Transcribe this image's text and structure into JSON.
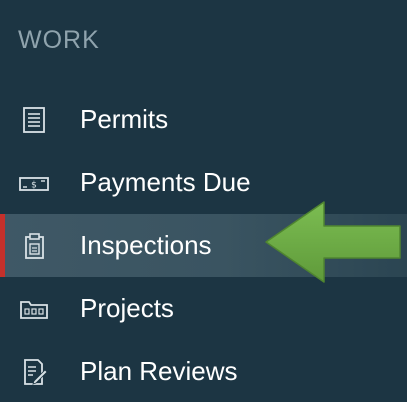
{
  "sidebar": {
    "section_title": "WORK",
    "items": [
      {
        "label": "Permits",
        "icon": "document-icon",
        "active": false
      },
      {
        "label": "Payments Due",
        "icon": "dollar-bill-icon",
        "active": false
      },
      {
        "label": "Inspections",
        "icon": "clipboard-icon",
        "active": true
      },
      {
        "label": "Projects",
        "icon": "folder-icon",
        "active": false
      },
      {
        "label": "Plan Reviews",
        "icon": "document-edit-icon",
        "active": false
      }
    ]
  },
  "colors": {
    "sidebar_background": "#1c3543",
    "active_background": "#3a5461",
    "active_accent": "#c4302b",
    "text": "#ffffff",
    "section_title": "#8fa3ad",
    "arrow": "#6aa842"
  }
}
